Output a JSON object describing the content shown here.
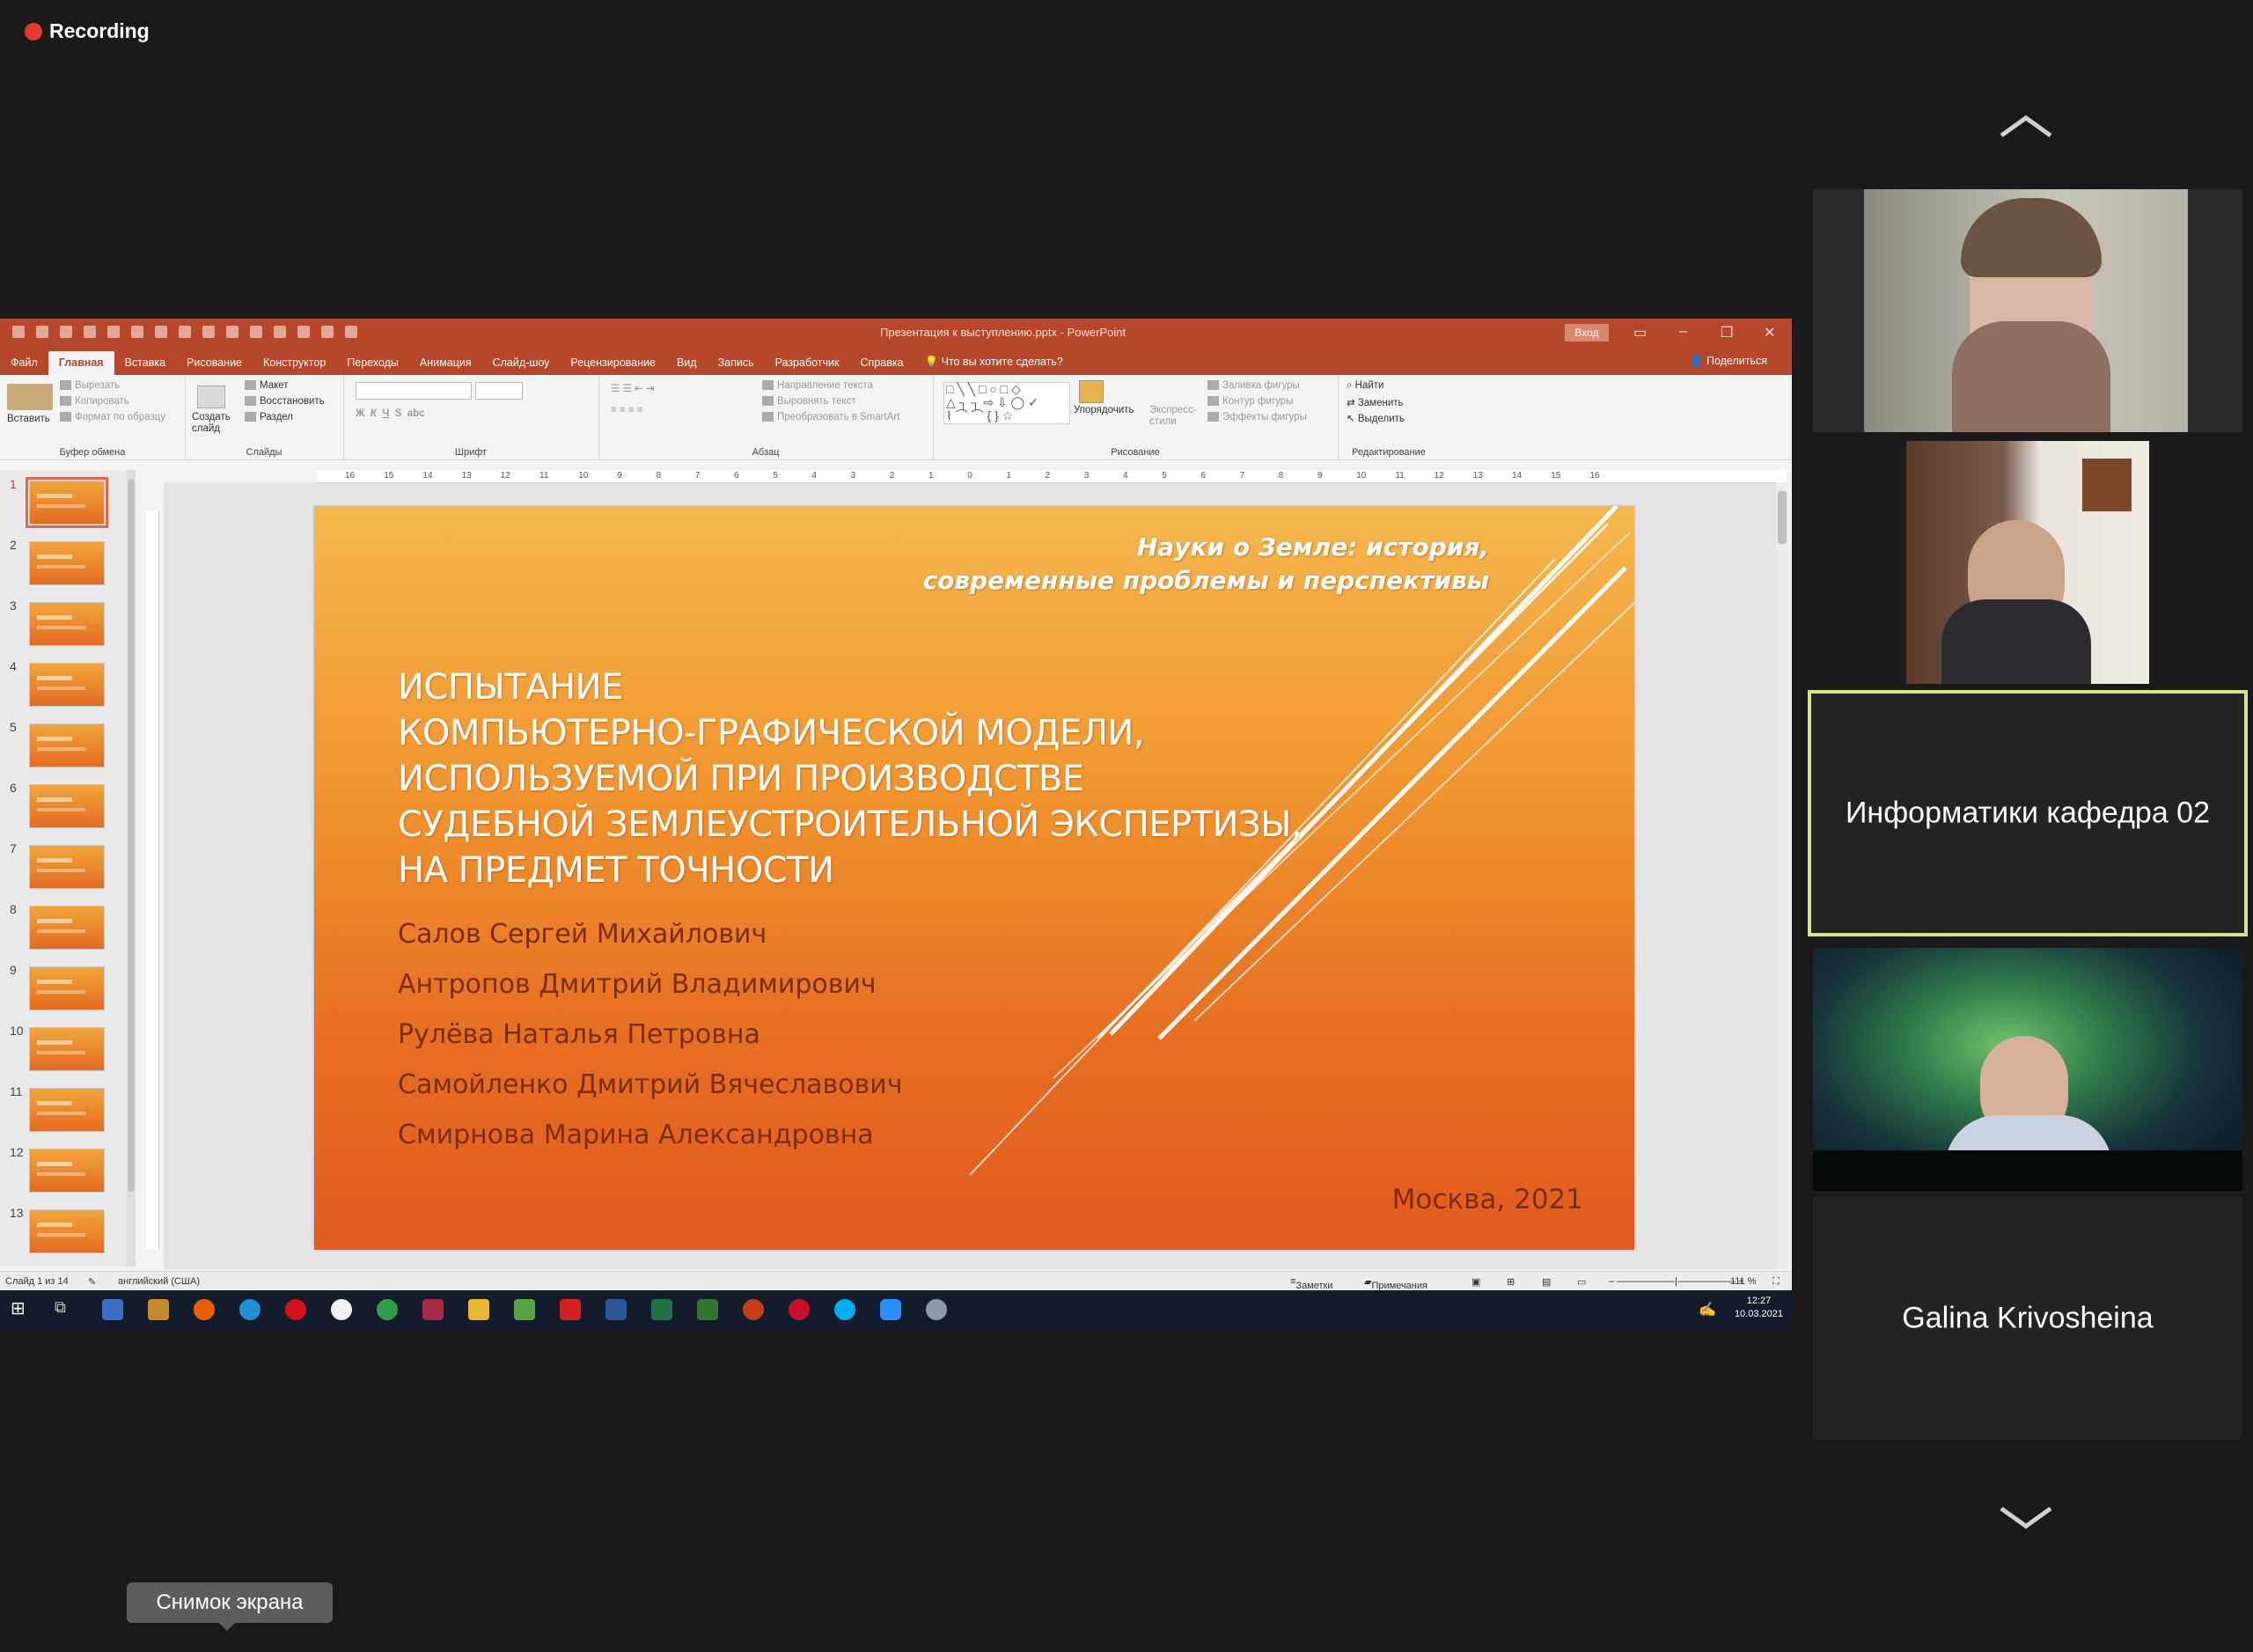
{
  "recording": {
    "label": "Recording"
  },
  "powerpoint": {
    "window_title": "Презентация к выступлению.pptx - PowerPoint",
    "login_button": "Вход",
    "tabs": [
      "Файл",
      "Главная",
      "Вставка",
      "Рисование",
      "Конструктор",
      "Переходы",
      "Анимация",
      "Слайд-шоу",
      "Рецензирование",
      "Вид",
      "Запись",
      "Разработчик",
      "Справка",
      "Что вы хотите сделать?"
    ],
    "share_label": "Поделиться",
    "ribbon": {
      "clipboard": {
        "paste": "Вставить",
        "cut": "Вырезать",
        "copy": "Копировать",
        "format": "Формат по образцу",
        "group": "Буфер обмена"
      },
      "slides": {
        "new": "Создать слайд",
        "layout": "Макет",
        "reset": "Восстановить",
        "section": "Раздел",
        "group": "Слайды"
      },
      "font": {
        "group": "Шрифт"
      },
      "paragraph": {
        "text_dir": "Направление текста",
        "align_text": "Выровнять текст",
        "smartart": "Преобразовать в SmartArt",
        "group": "Абзац"
      },
      "drawing": {
        "arrange": "Упорядочить",
        "quick_styles": "Экспресс-стили",
        "fill": "Заливка фигуры",
        "outline": "Контур фигуры",
        "effects": "Эффекты фигуры",
        "group": "Рисование"
      },
      "editing": {
        "find": "Найти",
        "replace": "Заменить",
        "select": "Выделить",
        "group": "Редактирование"
      }
    },
    "ruler_ticks": [
      "16",
      "15",
      "14",
      "13",
      "12",
      "11",
      "10",
      "9",
      "8",
      "7",
      "6",
      "5",
      "4",
      "3",
      "2",
      "1",
      "0",
      "1",
      "2",
      "3",
      "4",
      "5",
      "6",
      "7",
      "8",
      "9",
      "10",
      "11",
      "12",
      "13",
      "14",
      "15",
      "16"
    ],
    "thumbnail_numbers": [
      "1",
      "2",
      "3",
      "4",
      "5",
      "6",
      "7",
      "8",
      "9",
      "10",
      "11",
      "12",
      "13"
    ],
    "slide": {
      "subtitle_lines": [
        "Науки о Земле: история,",
        "современные проблемы и перспективы"
      ],
      "title_lines": [
        "Испытание",
        "компьютерно-графической модели,",
        "используемой при производстве",
        "судебной землеустроительной экспертизы,",
        "на предмет точности"
      ],
      "authors": [
        "Салов Сергей Михайлович",
        "Антропов Дмитрий Владимирович",
        "Рулёва Наталья Петровна",
        "Самойленко Дмитрий Вячеславович",
        "Смирнова Марина Александровна"
      ],
      "city_year": "Москва, 2021"
    },
    "status": {
      "slide_counter": "Слайд 1 из 14",
      "language": "английский (США)",
      "notes": "Заметки",
      "comments": "Примечания",
      "zoom": "111 %"
    },
    "taskbar": {
      "time": "12:27",
      "date": "10.03.2021"
    }
  },
  "participants": [
    {
      "type": "video",
      "desc": ""
    },
    {
      "type": "video",
      "desc": ""
    },
    {
      "type": "name",
      "name": "Информатики кафедра 02",
      "active": true
    },
    {
      "type": "video",
      "desc": ""
    },
    {
      "type": "name",
      "name": "Galina Krivosheina"
    }
  ],
  "tooltip": {
    "text": "Снимок экрана"
  },
  "colors": {
    "ppt_accent": "#b7472a",
    "active_speaker_border": "#d6e38a"
  }
}
